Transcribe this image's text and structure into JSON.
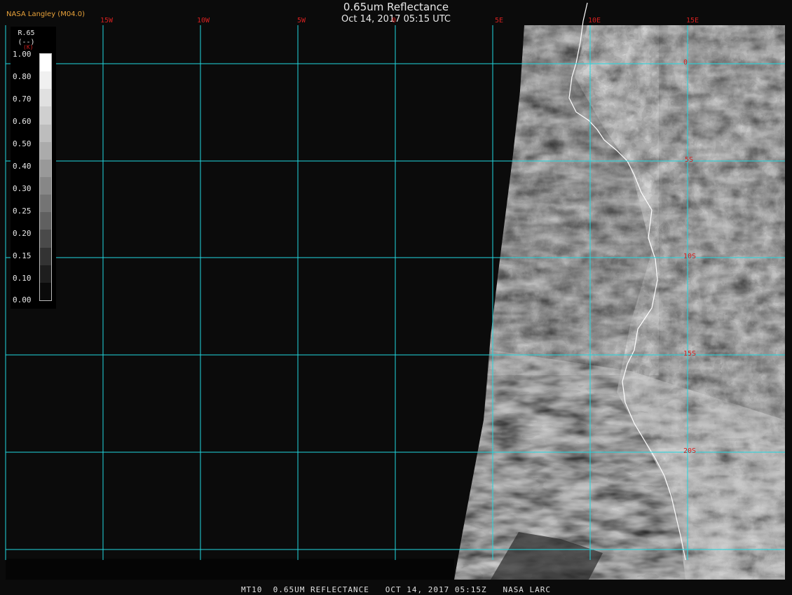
{
  "header": {
    "agency": "NASA Langley (M04.0)",
    "title": "0.65um Reflectance",
    "datetime": "Oct 14, 2017 05:15 UTC"
  },
  "footer": {
    "text": "MT10  0.65UM REFLECTANCE   OCT 14, 2017 05:15Z   NASA LARC"
  },
  "colorbar": {
    "title": "R.65",
    "units": "(--)",
    "marker": "(K)",
    "labels": [
      "1.00",
      "0.80",
      "0.70",
      "0.60",
      "0.50",
      "0.40",
      "0.30",
      "0.25",
      "0.20",
      "0.15",
      "0.10",
      "0.00"
    ],
    "grays": [
      "#ffffff",
      "#f0f0f0",
      "#e0e0e0",
      "#cfcfcf",
      "#bdbdbd",
      "#ababab",
      "#999999",
      "#878787",
      "#747474",
      "#606060",
      "#4a4a4a",
      "#333333",
      "#1e1e1e",
      "#0a0a0a"
    ]
  },
  "map": {
    "lon_labels": [
      "15W",
      "10W",
      "5W",
      "0",
      "5E",
      "10E",
      "15E"
    ],
    "lat_labels": [
      "0",
      "5S",
      "10S",
      "15S",
      "20S"
    ],
    "grid_color": "#20d8e0",
    "label_color": "#d42020",
    "coast_color": "#ffffff",
    "background": "#0b0b0b",
    "missing_data": "#050505"
  }
}
